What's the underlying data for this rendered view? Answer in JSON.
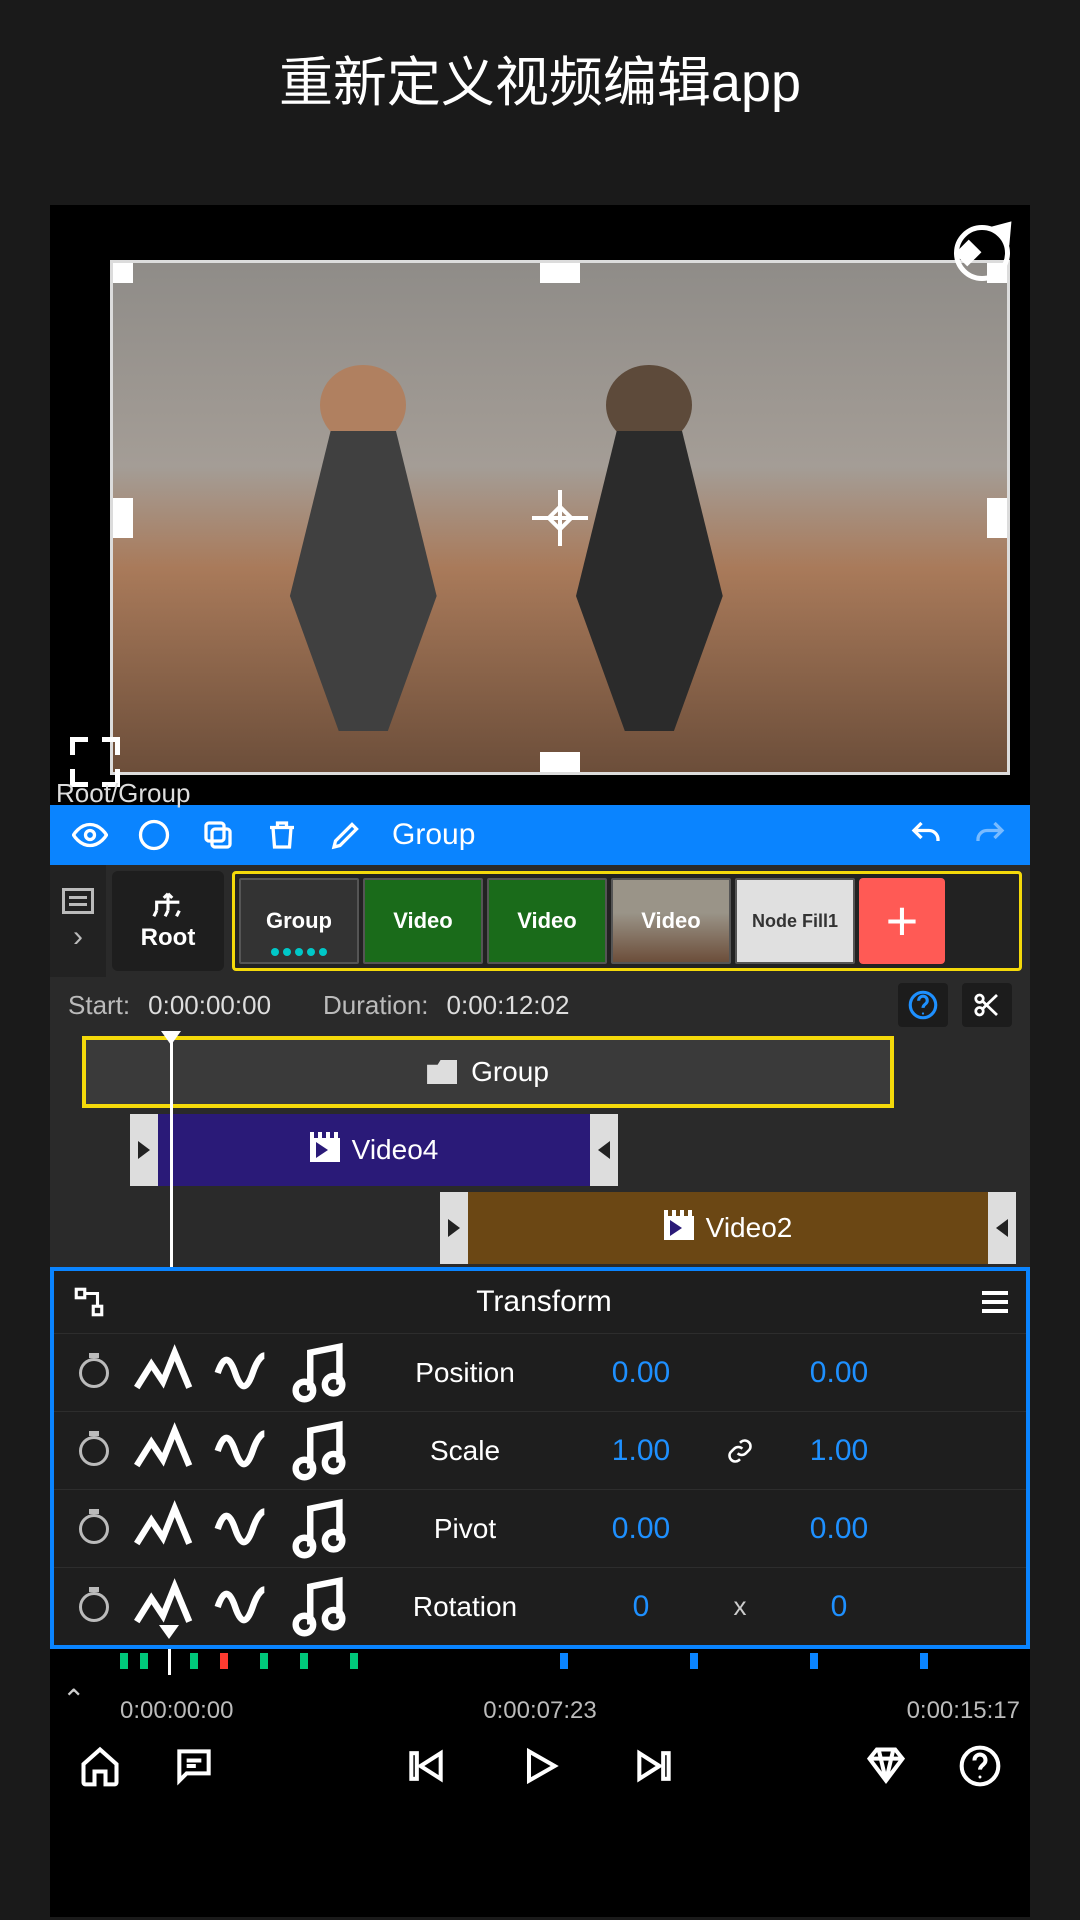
{
  "page_title": "重新定义视频编辑app",
  "breadcrumb": "Root/Group",
  "toolbar": {
    "group_label": "Group"
  },
  "nodes": {
    "root_label": "Root",
    "items": [
      {
        "label": "Group",
        "kind": "group"
      },
      {
        "label": "Video",
        "kind": "video"
      },
      {
        "label": "Video",
        "kind": "video"
      },
      {
        "label": "Video",
        "kind": "thumb"
      },
      {
        "label": "Node Fill1",
        "kind": "fill"
      }
    ],
    "add_label": "+"
  },
  "time_info": {
    "start_label": "Start:",
    "start_value": "0:00:00:00",
    "duration_label": "Duration:",
    "duration_value": "0:00:12:02"
  },
  "timeline": {
    "group_label": "Group",
    "video4_label": "Video4",
    "video2_label": "Video2"
  },
  "transform": {
    "title": "Transform",
    "rows": [
      {
        "label": "Position",
        "v1": "0.00",
        "link": "",
        "v2": "0.00"
      },
      {
        "label": "Scale",
        "v1": "1.00",
        "link": "link",
        "v2": "1.00"
      },
      {
        "label": "Pivot",
        "v1": "0.00",
        "link": "",
        "v2": "0.00"
      },
      {
        "label": "Rotation",
        "v1": "0",
        "link": "x",
        "v2": "0"
      }
    ]
  },
  "ruler": {
    "t0": "0:00:00:00",
    "t1": "0:00:07:23",
    "t2": "0:00:15:17"
  },
  "colors": {
    "accent_blue": "#0a84ff",
    "highlight_yellow": "#f4d90a",
    "add_red": "#ff5a55",
    "value_blue": "#1e90ff"
  }
}
